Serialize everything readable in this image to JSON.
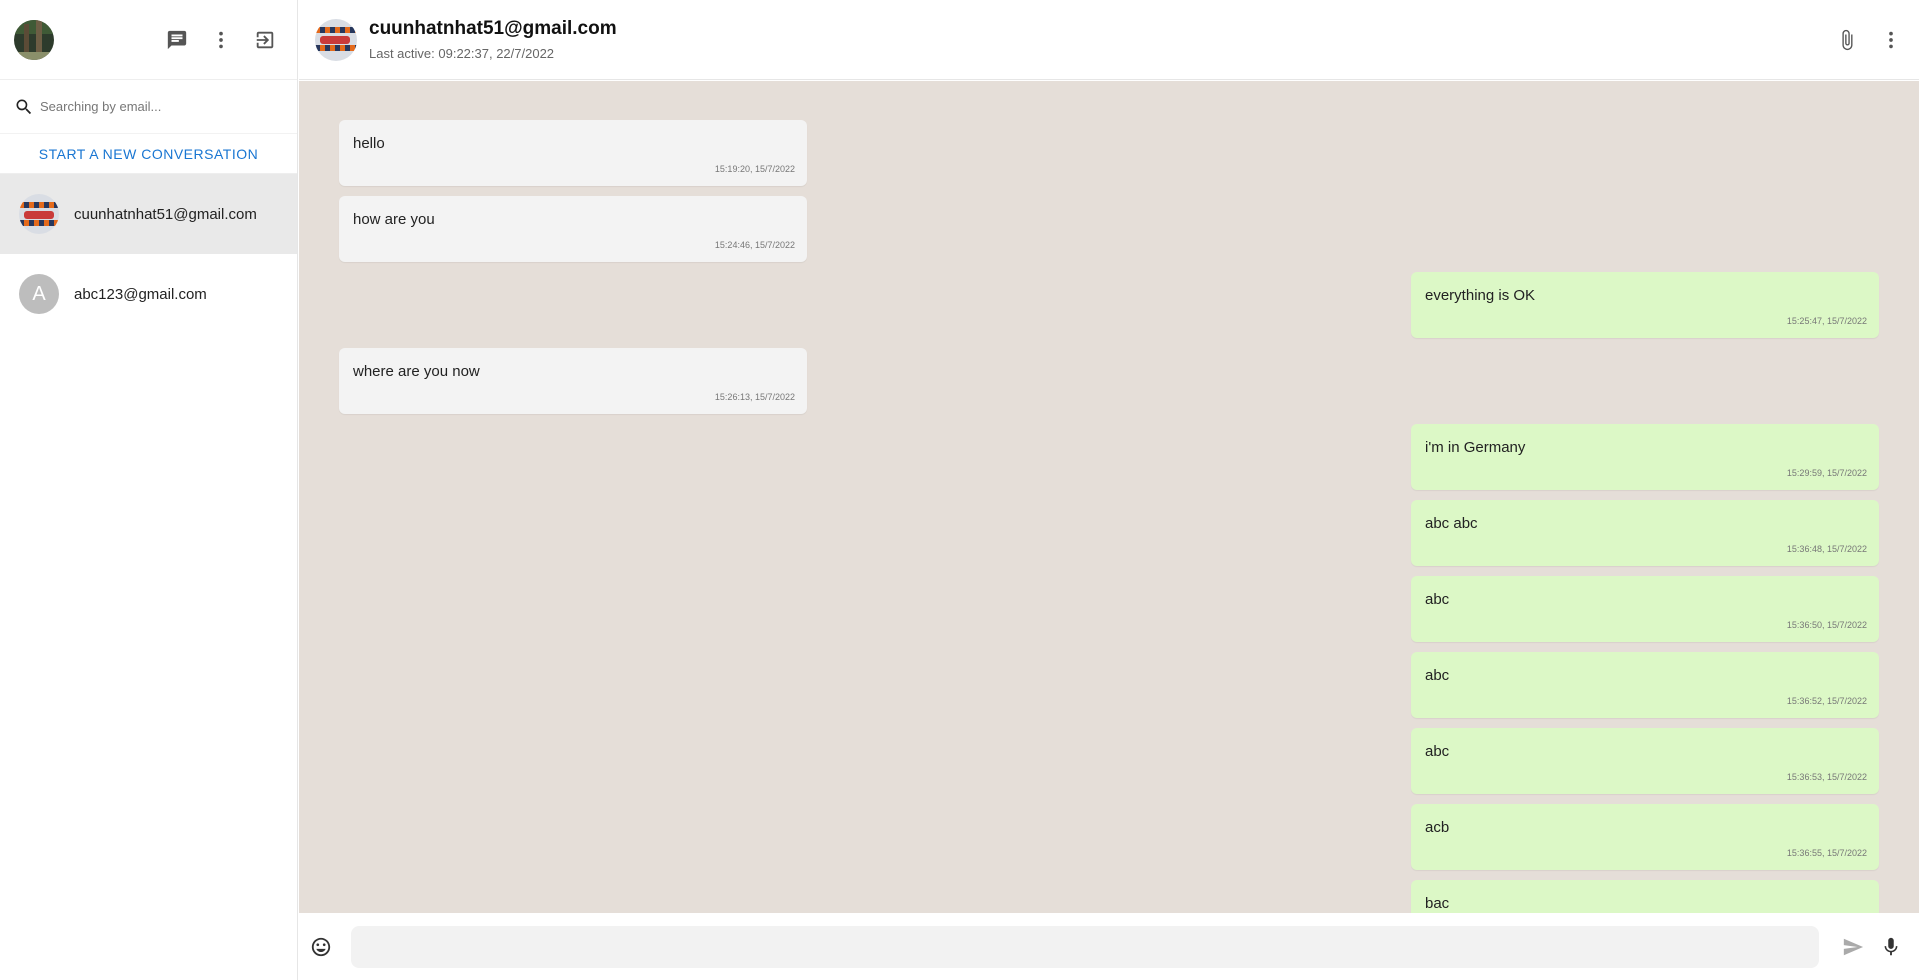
{
  "sidebar": {
    "search_placeholder": "Searching by email...",
    "new_conversation_label": "START A NEW CONVERSATION",
    "conversations": [
      {
        "email": "cuunhatnhat51@gmail.com",
        "avatar": "car-photo",
        "active": true
      },
      {
        "email": "abc123@gmail.com",
        "avatar_letter": "A",
        "active": false
      }
    ],
    "icons": [
      "chat-icon",
      "more-vert-icon",
      "logout-icon",
      "search-icon"
    ]
  },
  "chat": {
    "recipient_email": "cuunhatnhat51@gmail.com",
    "last_active": "Last active: 09:22:37, 22/7/2022",
    "messages": [
      {
        "direction": "in",
        "text": "hello",
        "time": "15:19:20, 15/7/2022"
      },
      {
        "direction": "in",
        "text": "how are you",
        "time": "15:24:46, 15/7/2022"
      },
      {
        "direction": "out",
        "text": "everything is OK",
        "time": "15:25:47, 15/7/2022"
      },
      {
        "direction": "in",
        "text": "where are you now",
        "time": "15:26:13, 15/7/2022"
      },
      {
        "direction": "out",
        "text": "i'm in Germany",
        "time": "15:29:59, 15/7/2022"
      },
      {
        "direction": "out",
        "text": "abc abc",
        "time": "15:36:48, 15/7/2022"
      },
      {
        "direction": "out",
        "text": "abc",
        "time": "15:36:50, 15/7/2022"
      },
      {
        "direction": "out",
        "text": "abc",
        "time": "15:36:52, 15/7/2022"
      },
      {
        "direction": "out",
        "text": "abc",
        "time": "15:36:53, 15/7/2022"
      },
      {
        "direction": "out",
        "text": "acb",
        "time": "15:36:55, 15/7/2022"
      },
      {
        "direction": "out",
        "text": "bac",
        "time": ""
      }
    ],
    "composer_value": "",
    "colors": {
      "incoming": "#f3f3f3",
      "outgoing": "#dcf8c6",
      "background": "#e5ded8",
      "accent": "#1976d2"
    }
  }
}
